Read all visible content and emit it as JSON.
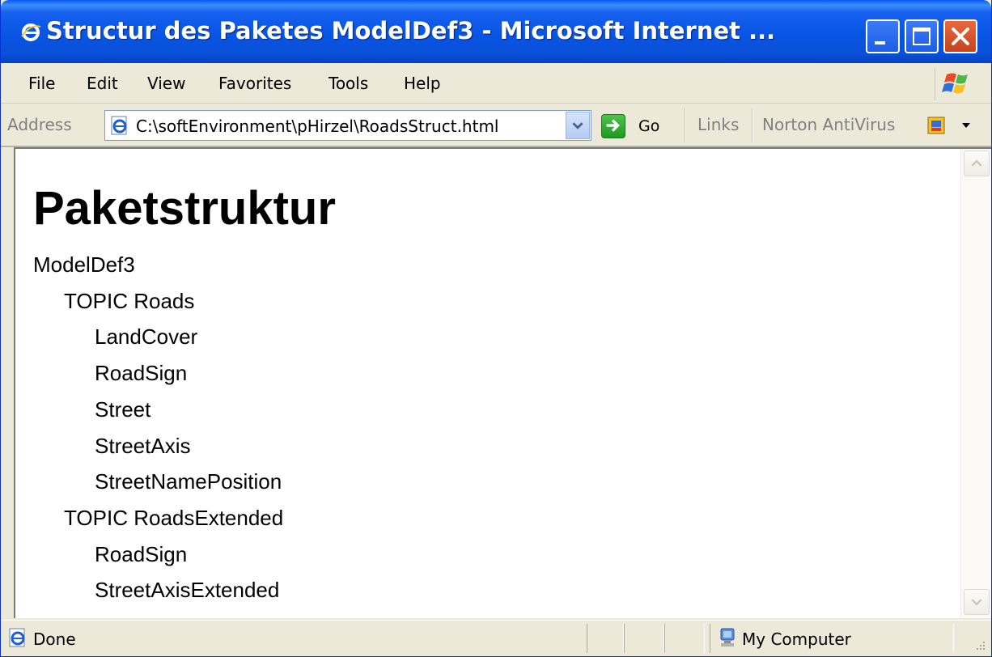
{
  "window": {
    "title": "Structur des Paketes ModelDef3 - Microsoft Internet ..."
  },
  "menu": {
    "items": [
      {
        "label": "File"
      },
      {
        "label": "Edit"
      },
      {
        "label": "View"
      },
      {
        "label": "Favorites"
      },
      {
        "label": "Tools"
      },
      {
        "label": "Help"
      }
    ]
  },
  "address_bar": {
    "label": "Address",
    "value": "C:\\softEnvironment\\pHirzel\\RoadsStruct.html",
    "go_label": "Go",
    "links_label": "Links",
    "toolbar_extra": "Norton AntiVirus"
  },
  "page": {
    "heading": "Paketstruktur",
    "tree": [
      {
        "text": "ModelDef3",
        "level": 0
      },
      {
        "text": "TOPIC Roads",
        "level": 1
      },
      {
        "text": "LandCover",
        "level": 2
      },
      {
        "text": "RoadSign",
        "level": 2
      },
      {
        "text": "Street",
        "level": 2
      },
      {
        "text": "StreetAxis",
        "level": 2
      },
      {
        "text": "StreetNamePosition",
        "level": 2
      },
      {
        "text": "TOPIC RoadsExtended",
        "level": 1
      },
      {
        "text": "RoadSign",
        "level": 2
      },
      {
        "text": "StreetAxisExtended",
        "level": 2
      }
    ]
  },
  "status_bar": {
    "status": "Done",
    "zone": "My Computer"
  },
  "colors": {
    "titlebar": "#0855E4",
    "window_bg": "#ECE9D8",
    "close_button": "#C6431E"
  }
}
